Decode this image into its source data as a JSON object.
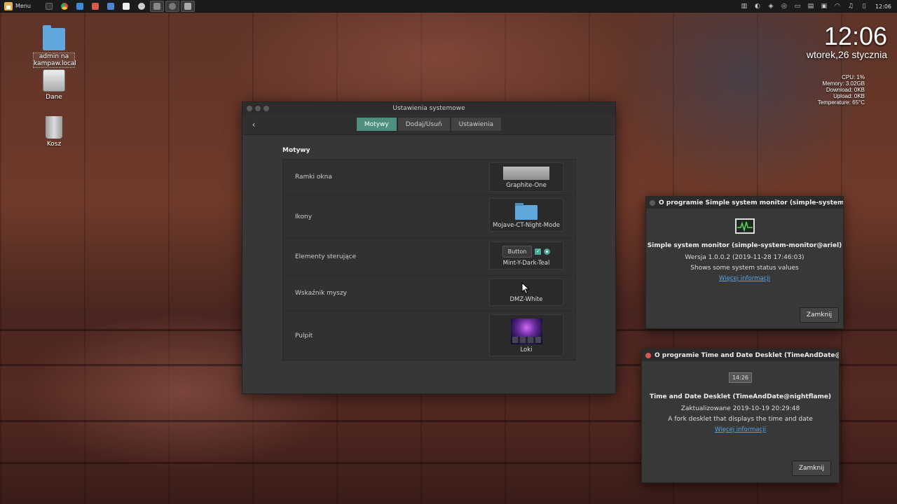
{
  "panel": {
    "menu_label": "Menu",
    "launchers": [
      "terminal-icon",
      "chrome-icon",
      "files-icon",
      "image-viewer-icon",
      "mail-icon",
      "text-editor-icon",
      "pointer-app-icon",
      "task-window-icon",
      "camera-window-icon",
      "settings-window-icon"
    ],
    "clock": "12:06"
  },
  "desktop": {
    "icons": [
      {
        "label_line1": "admin na",
        "label_line2": "kampaw.local"
      },
      {
        "label": "Dane"
      },
      {
        "label": "Kosz"
      }
    ]
  },
  "clock_desklet": {
    "time": "12:06",
    "date": "wtorek,26 stycznia"
  },
  "sysmon": {
    "cpu": "CPU: 1%",
    "memory": "Memory: 3.02GB",
    "download": "Download: 0KB",
    "upload": "Upload: 0KB",
    "temperature": "Temperature: 65°C"
  },
  "settings_window": {
    "title": "Ustawienia systemowe",
    "tabs": [
      "Motywy",
      "Dodaj/Usuń",
      "Ustawienia"
    ],
    "active_tab": "Motywy",
    "section_title": "Motywy",
    "rows": [
      {
        "label": "Ramki okna",
        "value": "Graphite-One"
      },
      {
        "label": "Ikony",
        "value": "Mojave-CT-Night-Mode"
      },
      {
        "label": "Elementy sterujące",
        "value": "Mint-Y-Dark-Teal",
        "preview_button": "Button"
      },
      {
        "label": "Wskaźnik myszy",
        "value": "DMZ-White"
      },
      {
        "label": "Pulpit",
        "value": "Loki"
      }
    ]
  },
  "about_monitor": {
    "title": "O programie Simple system monitor (simple-system-monitor@",
    "name": "Simple system monitor (simple-system-monitor@ariel)",
    "version": "Wersja 1.0.0.2 (2019-11-28 17:46:03)",
    "description": "Shows some system status values",
    "link": "Więcej informacji",
    "close": "Zamknij"
  },
  "about_time": {
    "title": "O programie Time and Date Desklet (TimeAndDate@nightflar",
    "icon_text": "14:26",
    "name": "Time and Date Desklet (TimeAndDate@nightflame)",
    "updated": "Zaktualizowane 2019-10-19 20:29:48",
    "description": "A fork desklet that displays the time and date",
    "link": "Więcej informacji",
    "close": "Zamknij"
  },
  "colors": {
    "accent": "#4e8f7f",
    "link": "#5aa4e6",
    "close_red": "#e05353"
  }
}
